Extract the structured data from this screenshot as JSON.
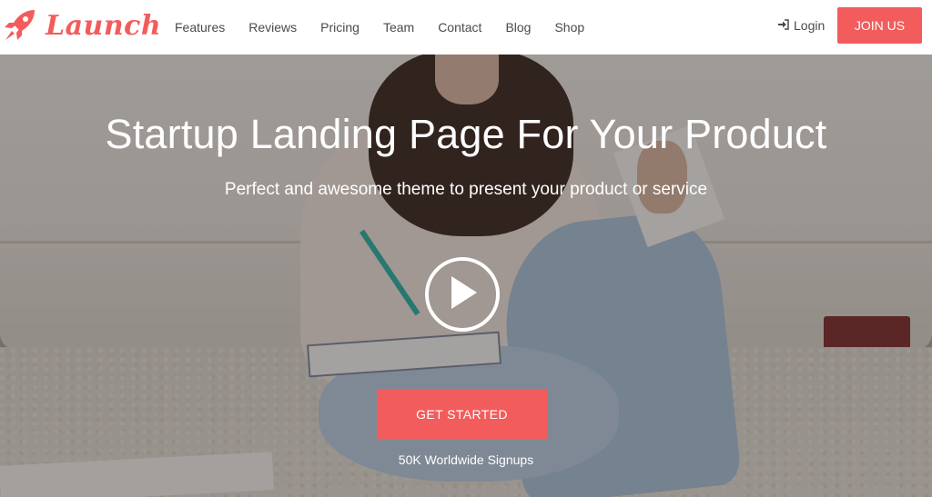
{
  "brand": {
    "name": "Launch",
    "accent_color": "#f35c5c",
    "logo_icon": "rocket-icon"
  },
  "nav": {
    "items": [
      {
        "label": "Features"
      },
      {
        "label": "Reviews"
      },
      {
        "label": "Pricing"
      },
      {
        "label": "Team"
      },
      {
        "label": "Contact"
      },
      {
        "label": "Blog"
      },
      {
        "label": "Shop"
      }
    ],
    "login_label": "Login",
    "login_icon": "sign-in-icon",
    "join_label": "JOIN US"
  },
  "hero": {
    "title": "Startup Landing Page For Your Product",
    "subtitle": "Perfect and awesome theme to present your product or service",
    "play_icon": "play-icon",
    "cta_label": "GET STARTED",
    "signups_text": "50K Worldwide Signups"
  }
}
